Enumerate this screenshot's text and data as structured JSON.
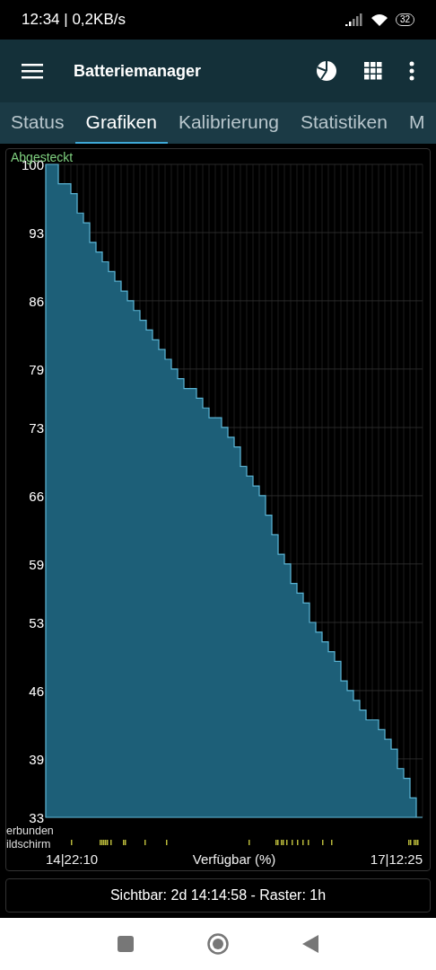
{
  "status_bar": {
    "time": "12:34 | 0,2KB/s",
    "battery": "32"
  },
  "app_bar": {
    "title": "Batteriemanager"
  },
  "tabs": [
    {
      "label": "Status",
      "selected": false
    },
    {
      "label": "Grafiken",
      "selected": true
    },
    {
      "label": "Kalibrierung",
      "selected": false
    },
    {
      "label": "Statistiken",
      "selected": false
    },
    {
      "label": "M",
      "selected": false
    }
  ],
  "chart": {
    "legend": "Abgesteckt",
    "row_labels": [
      "erbunden",
      "ildschirm"
    ],
    "start": "14|22:10",
    "end": "17|12:25",
    "chart_data": {
      "type": "area",
      "grid": true,
      "xlabel": "Verfügbar (%)",
      "ylim": [
        33,
        100
      ],
      "yticks": [
        100,
        93,
        86,
        79,
        73,
        66,
        59,
        53,
        46,
        39,
        33
      ],
      "values": [
        100,
        100,
        98,
        98,
        97,
        95,
        94,
        92,
        91,
        90,
        89,
        88,
        87,
        86,
        85,
        84,
        83,
        82,
        81,
        80,
        79,
        78,
        77,
        77,
        76,
        75,
        74,
        74,
        73,
        72,
        71,
        69,
        68,
        67,
        66,
        64,
        62,
        60,
        59,
        57,
        56,
        55,
        53,
        52,
        51,
        50,
        49,
        47,
        46,
        45,
        44,
        43,
        43,
        42,
        41,
        40,
        38,
        37,
        35,
        33
      ]
    }
  },
  "footer": {
    "text": "Sichtbar: 2d 14:14:58 - Raster: 1h"
  }
}
